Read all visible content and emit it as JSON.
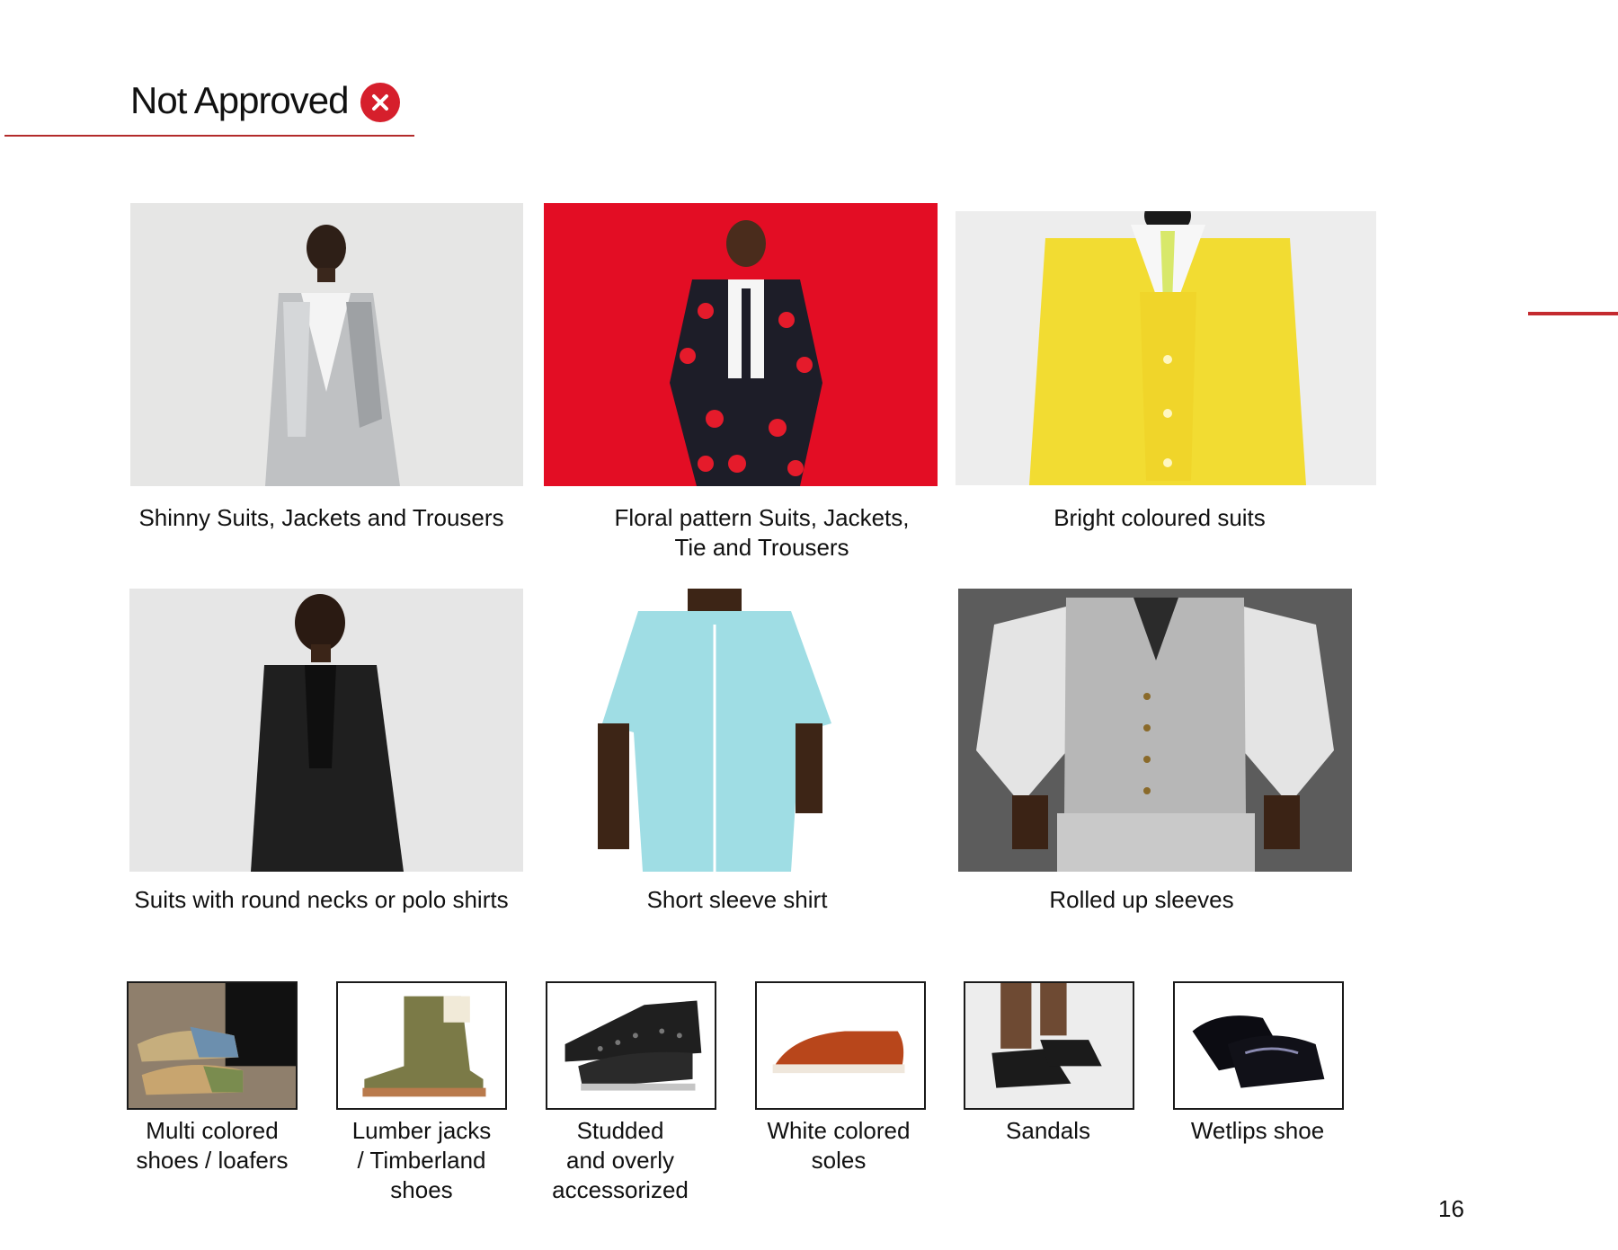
{
  "header": {
    "title": "Not Approved",
    "badge_icon": "close-circle-icon",
    "accent_color": "#d61f2c"
  },
  "outfits": [
    {
      "caption": "Shinny Suits, Jackets and Trousers",
      "image": "silver-suit-photo"
    },
    {
      "caption_line1": "Floral pattern Suits, Jackets,",
      "caption_line2": "Tie and Trousers",
      "image": "heart-pattern-suit-photo"
    },
    {
      "caption": "Bright coloured suits",
      "image": "yellow-suit-photo"
    },
    {
      "caption": "Suits with round necks or polo shirts",
      "image": "black-suit-round-neck-photo"
    },
    {
      "caption": "Short sleeve shirt",
      "image": "short-sleeve-shirt-photo"
    },
    {
      "caption": "Rolled up sleeves",
      "image": "rolled-sleeves-vest-photo"
    }
  ],
  "shoes": [
    {
      "line1": "Multi colored",
      "line2": "shoes / loafers",
      "image": "multicolor-loafers-photo"
    },
    {
      "line1": "Lumber jacks",
      "line2": "/ Timberland",
      "line3": "shoes",
      "image": "timberland-boot-photo"
    },
    {
      "line1": "Studded",
      "line2": "and overly",
      "line3": "accessorized",
      "image": "studded-sneaker-photo"
    },
    {
      "line1": "White colored",
      "line2": "soles",
      "image": "white-sole-loafer-photo"
    },
    {
      "line1": "Sandals",
      "image": "sandals-photo"
    },
    {
      "line1": "Wetlips shoe",
      "image": "patent-leather-shoe-photo"
    }
  ],
  "page_number": "16"
}
